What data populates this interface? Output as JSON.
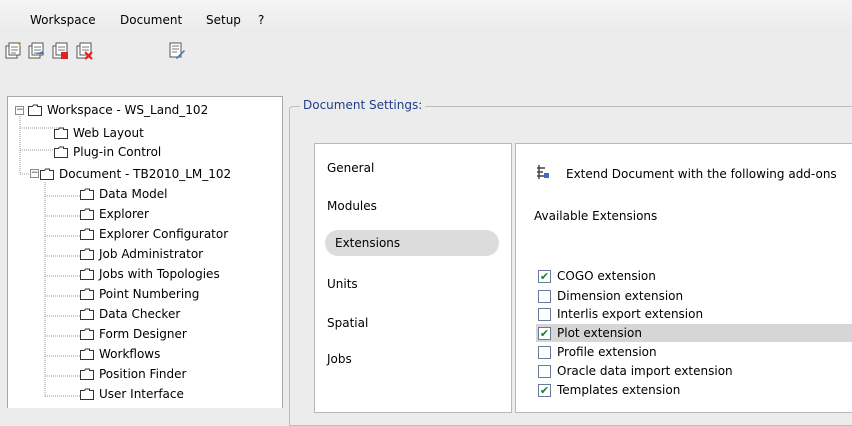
{
  "menu": [
    "Workspace",
    "Document",
    "Setup",
    "?"
  ],
  "toolbar": {
    "icons": [
      "new-document-icon",
      "open-document-icon",
      "close-document-icon",
      "delete-document-icon",
      "properties-icon"
    ]
  },
  "tree": {
    "nodes": [
      {
        "label": "Workspace - WS_Land_102",
        "expanded": true
      },
      {
        "label": "Web Layout"
      },
      {
        "label": "Plug-in Control"
      },
      {
        "label": "Document - TB2010_LM_102",
        "expanded": true,
        "selected": true
      },
      {
        "label": "Data Model"
      },
      {
        "label": "Explorer"
      },
      {
        "label": "Explorer Configurator"
      },
      {
        "label": "Job Administrator"
      },
      {
        "label": "Jobs with Topologies"
      },
      {
        "label": "Point Numbering"
      },
      {
        "label": "Data Checker"
      },
      {
        "label": "Form Designer"
      },
      {
        "label": "Workflows"
      },
      {
        "label": "Position Finder"
      },
      {
        "label": "User Interface"
      }
    ]
  },
  "settings": {
    "title": "Document Settings:",
    "tabs": [
      "General",
      "Modules",
      "Extensions",
      "Units",
      "Spatial",
      "Jobs"
    ],
    "selected_tab": "Extensions"
  },
  "content": {
    "header": "Extend Document with the following add-ons",
    "available_label": "Available Extensions",
    "extensions": [
      {
        "label": "COGO extension",
        "checked": true
      },
      {
        "label": "Dimension extension",
        "checked": false
      },
      {
        "label": "Interlis export extension",
        "checked": false
      },
      {
        "label": "Plot extension",
        "checked": true,
        "highlight": true
      },
      {
        "label": "Profile extension",
        "checked": false
      },
      {
        "label": "Oracle data import extension",
        "checked": false
      },
      {
        "label": "Templates extension",
        "checked": true
      }
    ]
  },
  "colors": {
    "group_title": "#1f3d8a",
    "check": "#1b7f2a",
    "selection": "#dcdcdc"
  }
}
